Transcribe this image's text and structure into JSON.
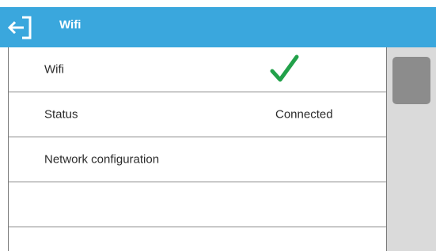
{
  "header": {
    "title": "Wifi",
    "back_icon": "back-arrow-icon",
    "color": "#3aa7dd"
  },
  "list": {
    "items": [
      {
        "label": "Wifi",
        "value_icon": "checkmark-icon",
        "value_color": "#22a14a"
      },
      {
        "label": "Status",
        "value": "Connected"
      },
      {
        "label": "Network configuration"
      },
      {
        "label": ""
      },
      {
        "label": ""
      }
    ]
  },
  "scrollbar": {
    "track_color": "#dadada",
    "thumb_color": "#8c8c8c"
  }
}
